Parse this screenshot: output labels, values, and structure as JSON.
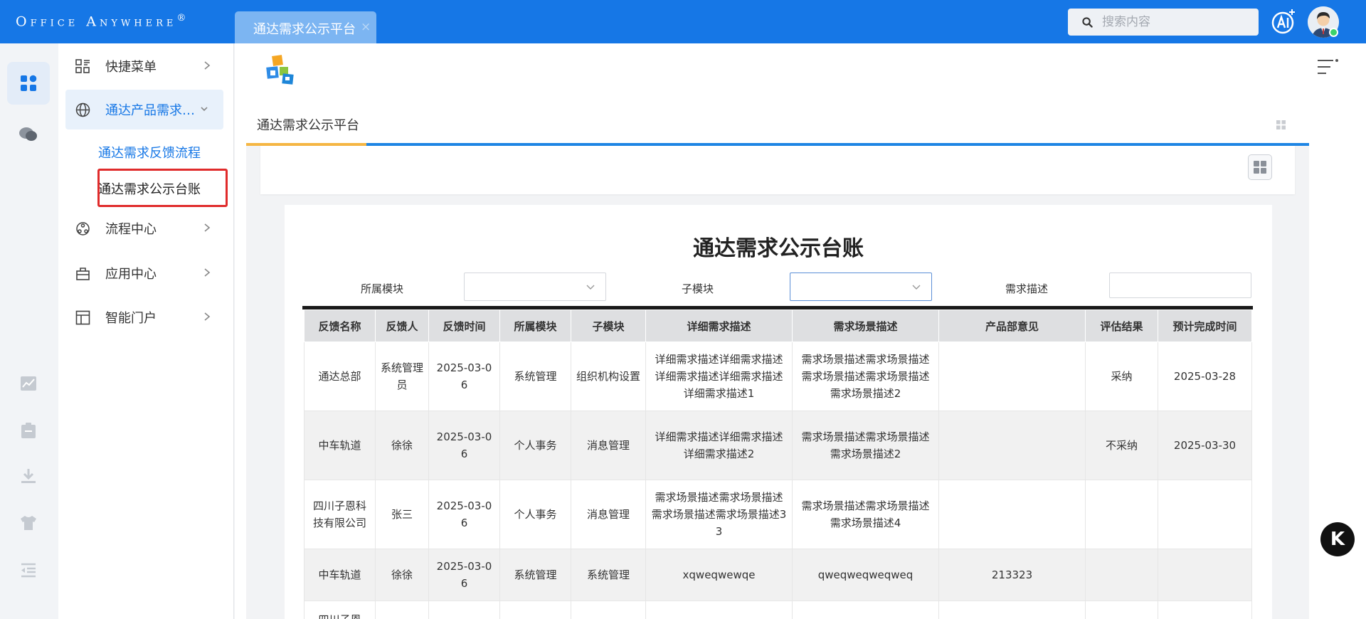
{
  "app": {
    "logo_text": "Office Anywhere",
    "logo_mark": "®"
  },
  "tabs": [
    {
      "label": "通达需求公示平台",
      "close": "×"
    }
  ],
  "search": {
    "placeholder": "搜索内容"
  },
  "sidebar": {
    "items": [
      {
        "label": "快捷菜单",
        "icon": "grid-apps-icon"
      },
      {
        "label": "通达产品需求反馈",
        "icon": "globe-icon",
        "expanded": true,
        "children": [
          {
            "label": "通达需求反馈流程"
          },
          {
            "label": "通达需求公示台账"
          }
        ]
      },
      {
        "label": "流程中心",
        "icon": "workflow-icon"
      },
      {
        "label": "应用中心",
        "icon": "briefcase-icon"
      },
      {
        "label": "智能门户",
        "icon": "portal-icon"
      }
    ]
  },
  "portal": {
    "tab_label": "通达需求公示平台"
  },
  "report": {
    "title": "通达需求公示台账",
    "filters": {
      "module_label": "所属模块",
      "submodule_label": "子模块",
      "desc_label": "需求描述"
    },
    "columns": [
      "反馈名称",
      "反馈人",
      "反馈时间",
      "所属模块",
      "子模块",
      "详细需求描述",
      "需求场景描述",
      "产品部意见",
      "评估结果",
      "预计完成时间"
    ],
    "rows": [
      [
        "通达总部",
        "系统管理员",
        "2025-03-06",
        "系统管理",
        "组织机构设置",
        "详细需求描述详细需求描述详细需求描述详细需求描述详细需求描述1",
        "需求场景描述需求场景描述需求场景描述需求场景描述需求场景描述2",
        "",
        "采纳",
        "2025-03-28"
      ],
      [
        "中车轨道",
        "徐徐",
        "2025-03-06",
        "个人事务",
        "消息管理",
        "详细需求描述详细需求描述详细需求描述2",
        "需求场景描述需求场景描述需求场景描述2",
        "",
        "不采纳",
        "2025-03-30"
      ],
      [
        "四川子恩科技有限公司",
        "张三",
        "2025-03-06",
        "个人事务",
        "消息管理",
        "需求场景描述需求场景描述需求场景描述需求场景描述33",
        "需求场景描述需求场景描述需求场景描述4",
        "",
        "",
        ""
      ],
      [
        "中车轨道",
        "徐徐",
        "2025-03-06",
        "系统管理",
        "系统管理",
        "xqweqwewqe",
        "qweqweqweqweq",
        "213323",
        "",
        ""
      ],
      [
        "四川子恩",
        "",
        "",
        "",
        "",
        "",
        "",
        "",
        "",
        ""
      ]
    ]
  },
  "floating": {
    "badge_label": "K"
  },
  "colors": {
    "primary": "#1677e6",
    "accent": "#f5b643",
    "highlight": "#e02b2b"
  }
}
